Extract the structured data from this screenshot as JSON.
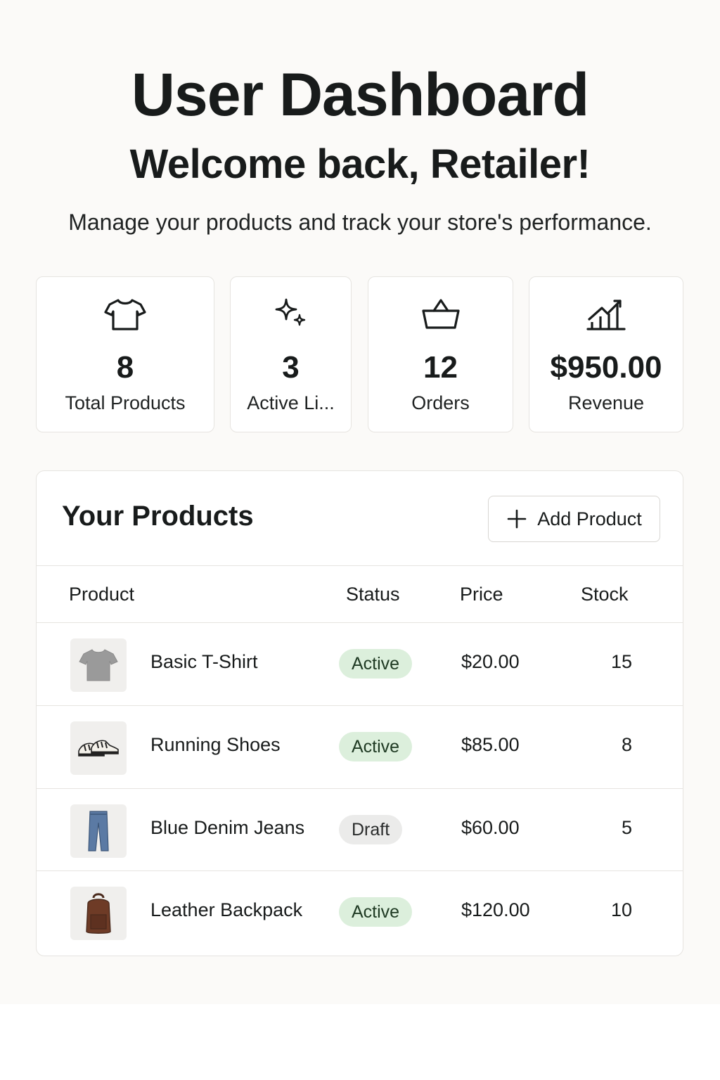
{
  "header": {
    "title": "User Dashboard",
    "welcome": "Welcome back, Retailer!",
    "subtitle": "Manage your products and track your store's performance."
  },
  "stats": [
    {
      "icon": "tshirt-icon",
      "value": "8",
      "label": "Total Products"
    },
    {
      "icon": "sparkles-icon",
      "value": "3",
      "label": "Active Li..."
    },
    {
      "icon": "basket-icon",
      "value": "12",
      "label": "Orders"
    },
    {
      "icon": "chart-up-icon",
      "value": "$950.00",
      "label": "Revenue"
    }
  ],
  "products_panel": {
    "title": "Your Products",
    "add_button_label": "Add Product",
    "columns": {
      "product": "Product",
      "status": "Status",
      "price": "Price",
      "stock": "Stock"
    },
    "rows": [
      {
        "name": "Basic T-Shirt",
        "status": "Active",
        "price": "$20.00",
        "stock": "15",
        "thumb": "tshirt-thumbnail"
      },
      {
        "name": "Running Shoes",
        "status": "Active",
        "price": "$85.00",
        "stock": "8",
        "thumb": "shoes-thumbnail"
      },
      {
        "name": "Blue Denim Jeans",
        "status": "Draft",
        "price": "$60.00",
        "stock": "5",
        "thumb": "jeans-thumbnail"
      },
      {
        "name": "Leather Backpack",
        "status": "Active",
        "price": "$120.00",
        "stock": "10",
        "thumb": "backpack-thumbnail"
      }
    ]
  },
  "colors": {
    "background": "#fbfaf8",
    "active_badge": "#dcefdc",
    "draft_badge": "#ebebea",
    "text": "#181b1b"
  }
}
